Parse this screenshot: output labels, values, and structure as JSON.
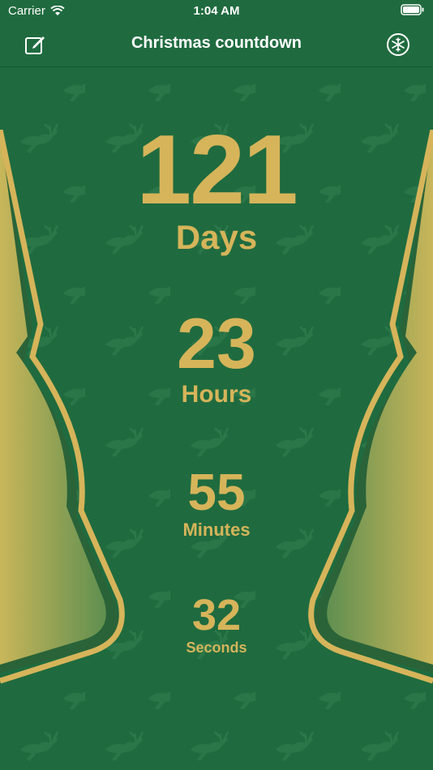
{
  "status": {
    "carrier": "Carrier",
    "time": "1:04 AM"
  },
  "nav": {
    "title": "Christmas countdown",
    "left_icon": "edit-icon",
    "right_icon": "snowflake-icon"
  },
  "countdown": {
    "days": {
      "value": "121",
      "label": "Days"
    },
    "hours": {
      "value": "23",
      "label": "Hours"
    },
    "minutes": {
      "value": "55",
      "label": "Minutes"
    },
    "seconds": {
      "value": "32",
      "label": "Seconds"
    }
  },
  "colors": {
    "background": "#1f6b3f",
    "accent_gold": "#d6b45a",
    "title_white": "#ffffff"
  }
}
